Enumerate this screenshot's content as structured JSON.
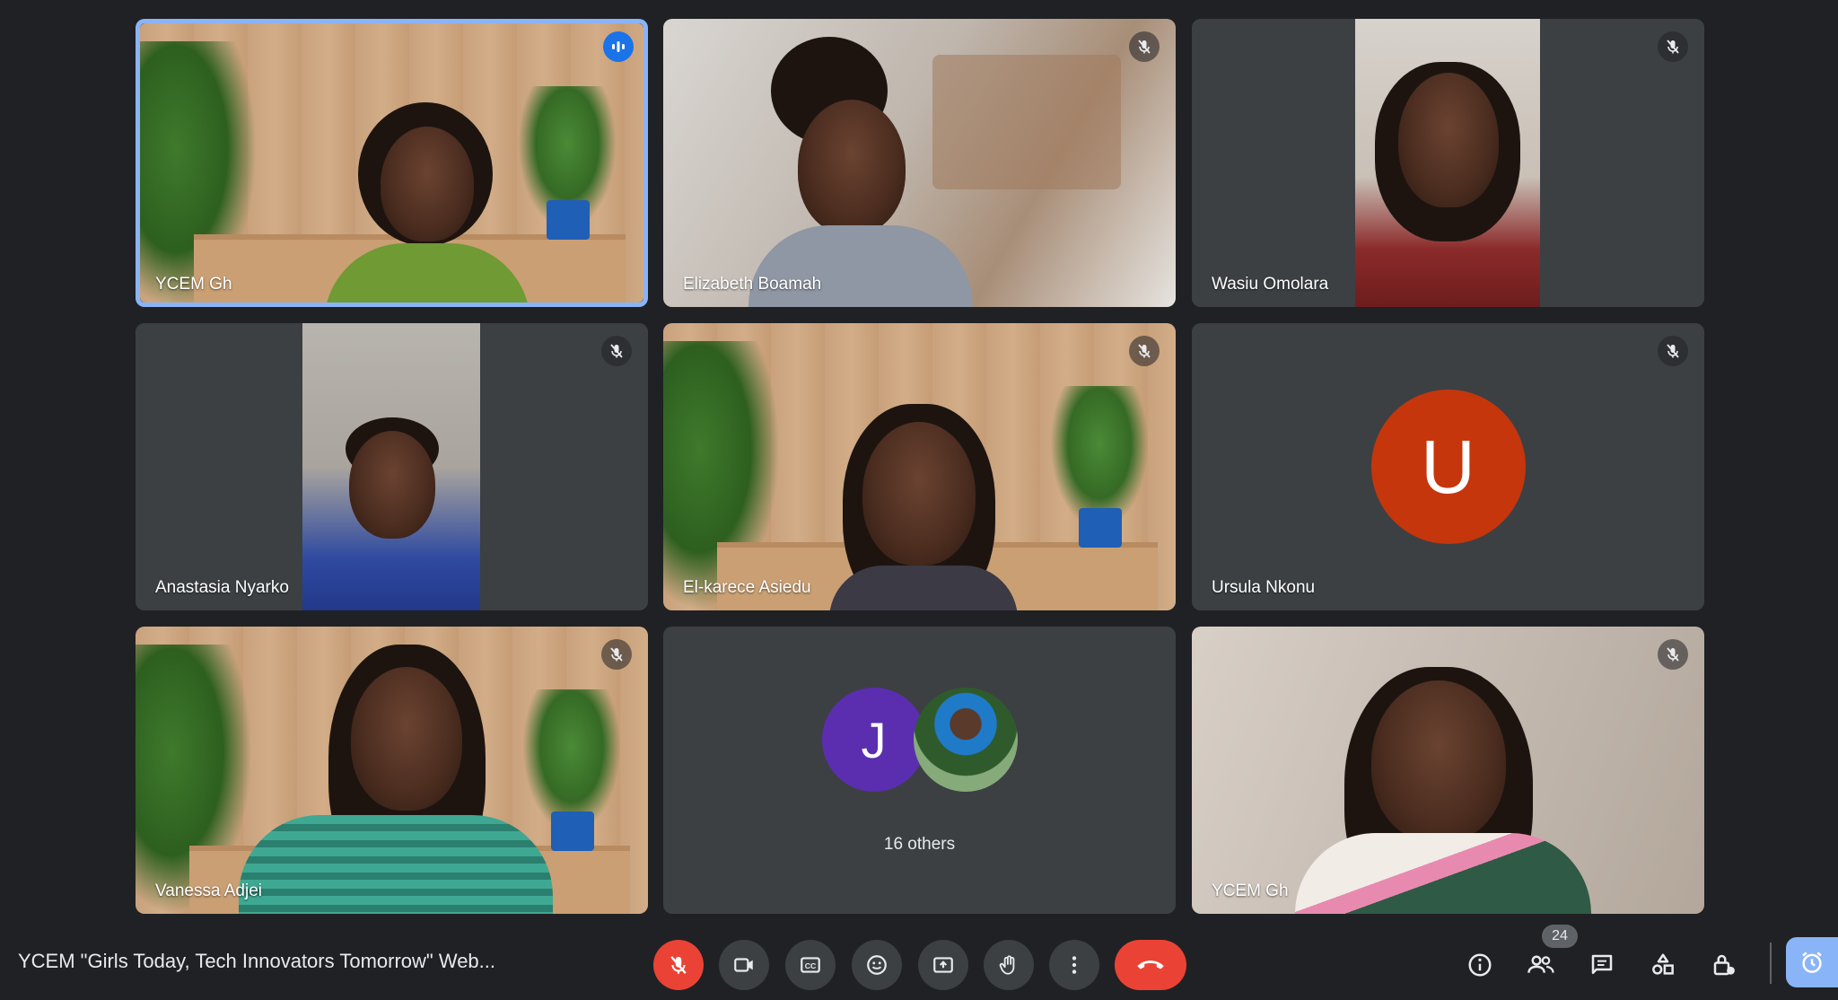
{
  "participants": [
    {
      "name": "YCEM Gh",
      "state": "speaking"
    },
    {
      "name": "Elizabeth Boamah",
      "state": "muted"
    },
    {
      "name": "Wasiu Omolara",
      "state": "muted"
    },
    {
      "name": "Anastasia Nyarko",
      "state": "muted"
    },
    {
      "name": "El-karece Asiedu",
      "state": "muted"
    },
    {
      "name": "Ursula Nkonu",
      "state": "muted",
      "avatar_letter": "U",
      "avatar_color": "#c5360c"
    },
    {
      "name": "Vanessa Adjei",
      "state": "muted"
    },
    {
      "name": "YCEM Gh",
      "state": "muted"
    }
  ],
  "others": {
    "label": "16 others",
    "avatar_letter": "J",
    "avatar_color": "#5b2eb0"
  },
  "meeting": {
    "title": "YCEM \"Girls Today, Tech Innovators Tomorrow\" Web..."
  },
  "controls": {
    "mic": "mic-off-icon",
    "camera": "videocam-icon",
    "captions": "closed-captions-icon",
    "emoji": "emoji-icon",
    "present": "present-screen-icon",
    "raise_hand": "raise-hand-icon",
    "more": "more-options-icon",
    "leave": "end-call-icon"
  },
  "right_controls": {
    "people_count": "24"
  },
  "colors": {
    "accent": "#8ab4f8",
    "danger": "#ea4335",
    "background": "#202124",
    "tile": "#3c4043"
  }
}
